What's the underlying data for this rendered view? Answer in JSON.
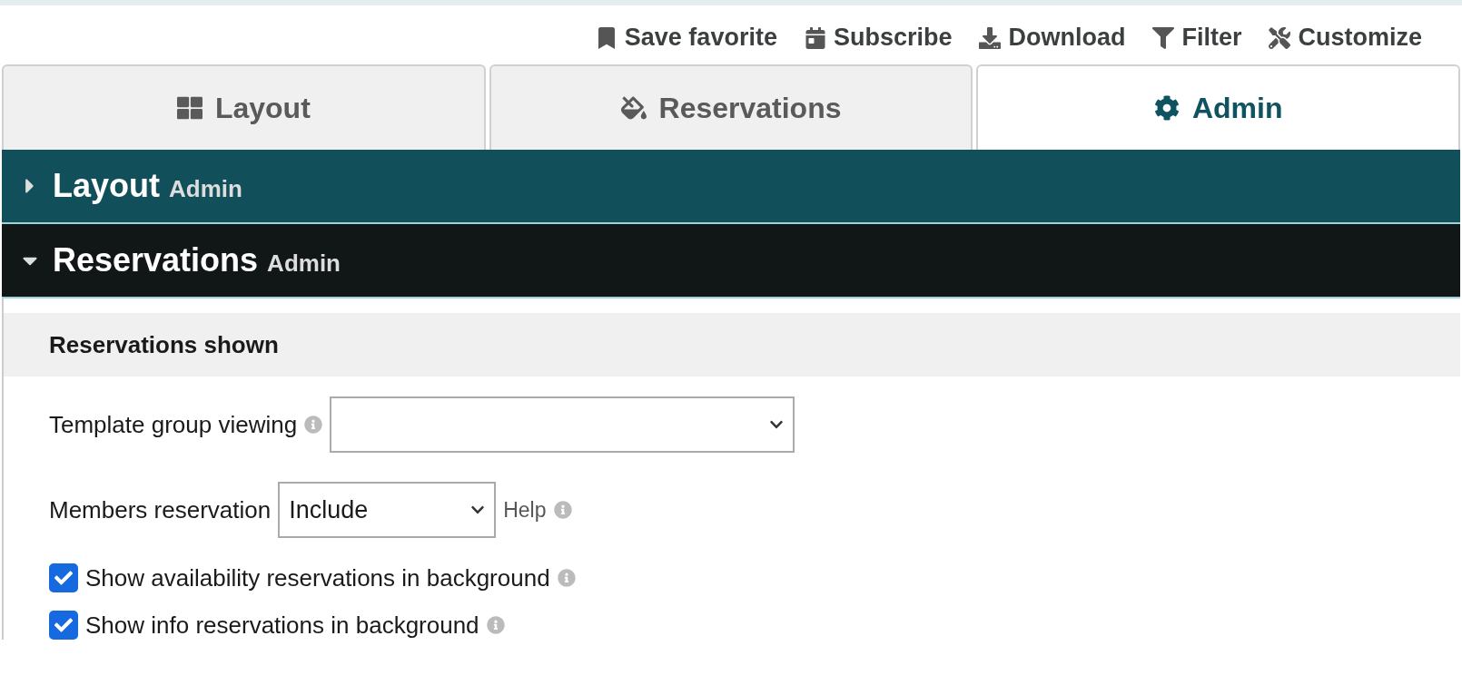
{
  "toolbar": [
    {
      "label": "Save favorite"
    },
    {
      "label": "Subscribe"
    },
    {
      "label": "Download"
    },
    {
      "label": "Filter"
    },
    {
      "label": "Customize"
    }
  ],
  "tabs": [
    {
      "label": "Layout",
      "selected": false
    },
    {
      "label": "Reservations",
      "selected": false
    },
    {
      "label": "Admin",
      "selected": true
    }
  ],
  "panels": [
    {
      "title": "Layout",
      "subtitle": "Admin",
      "expanded": false
    },
    {
      "title": "Reservations",
      "subtitle": "Admin",
      "expanded": true,
      "section": "Reservations shown",
      "fields": [
        {
          "kind": "select",
          "label": "Template group viewing"
        },
        {
          "kind": "select",
          "label": "Members reservation",
          "value": "Include",
          "help": "Help"
        },
        {
          "kind": "checkbox",
          "label": "Show availability reservations in background",
          "checked": true
        },
        {
          "kind": "checkbox",
          "label": "Show info reservations in background",
          "checked": true
        }
      ]
    }
  ]
}
